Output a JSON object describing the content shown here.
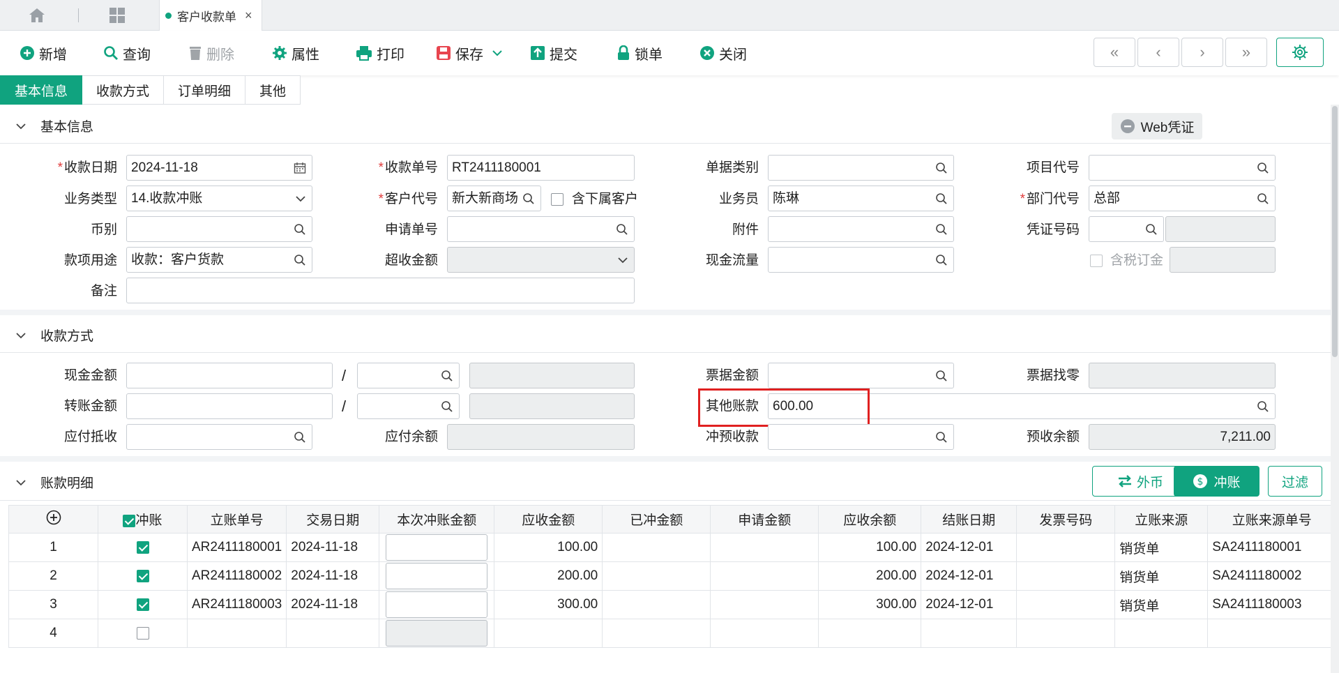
{
  "tabstrip": {
    "doc_tab_label": "客户收款单",
    "close_glyph": "×"
  },
  "toolbar": {
    "new": "新增",
    "query": "查询",
    "delete": "删除",
    "properties": "属性",
    "print": "打印",
    "save": "保存",
    "submit": "提交",
    "lock": "锁单",
    "close": "关闭",
    "nav_first": "«",
    "nav_prev": "‹",
    "nav_next": "›",
    "nav_last": "»"
  },
  "section_tabs": [
    "基本信息",
    "收款方式",
    "订单明细",
    "其他"
  ],
  "basic": {
    "title": "基本信息",
    "web_voucher": "Web凭证",
    "labels": {
      "receipt_date": "收款日期",
      "receipt_no": "收款单号",
      "doc_type": "单据类别",
      "project_code": "项目代号",
      "biz_type": "业务类型",
      "customer_code": "客户代号",
      "include_sub": "含下属客户",
      "salesperson": "业务员",
      "dept_code": "部门代号",
      "currency": "币别",
      "apply_no": "申请单号",
      "attachment": "附件",
      "voucher_no": "凭证号码",
      "purpose": "款项用途",
      "over_amount": "超收金额",
      "cash_flow": "现金流量",
      "tax_deposit": "含税订金",
      "remark": "备注"
    },
    "values": {
      "receipt_date": "2024-11-18",
      "receipt_no": "RT2411180001",
      "doc_type": "",
      "project_code": "",
      "biz_type": "14.收款冲账",
      "customer_code": "新大新商场",
      "salesperson": "陈琳",
      "dept_code": "总部",
      "currency": "",
      "apply_no": "",
      "attachment": "",
      "voucher_no": "",
      "purpose": "收款：客户货款",
      "over_amount": "",
      "cash_flow": "",
      "remark": ""
    }
  },
  "payment": {
    "title": "收款方式",
    "labels": {
      "cash_amount": "现金金额",
      "bill_amount": "票据金额",
      "bill_change": "票据找零",
      "transfer_amount": "转账金额",
      "other_account": "其他账款",
      "payable_offset": "应付抵收",
      "payable_balance": "应付余额",
      "offset_prepaid": "冲预收款",
      "prepaid_balance": "预收余额"
    },
    "values": {
      "other_account": "600.00",
      "prepaid_balance": "7,211.00"
    }
  },
  "ledger": {
    "title": "账款明细",
    "buttons": {
      "foreign": "外币",
      "offset": "冲账",
      "filter": "过滤"
    },
    "columns": [
      "冲账",
      "立账单号",
      "交易日期",
      "本次冲账金额",
      "应收金额",
      "已冲金额",
      "申请金额",
      "应收余额",
      "结账日期",
      "发票号码",
      "立账来源",
      "立账来源单号"
    ],
    "rows": [
      {
        "no": "1",
        "checked": true,
        "ar_no": "AR2411180001",
        "date": "2024-11-18",
        "receivable": "100.00",
        "balance": "100.00",
        "close_date": "2024-12-01",
        "source": "销货单",
        "source_no": "SA2411180001"
      },
      {
        "no": "2",
        "checked": true,
        "ar_no": "AR2411180002",
        "date": "2024-11-18",
        "receivable": "200.00",
        "balance": "200.00",
        "close_date": "2024-12-01",
        "source": "销货单",
        "source_no": "SA2411180002"
      },
      {
        "no": "3",
        "checked": true,
        "ar_no": "AR2411180003",
        "date": "2024-11-18",
        "receivable": "300.00",
        "balance": "300.00",
        "close_date": "2024-12-01",
        "source": "销货单",
        "source_no": "SA2411180003"
      },
      {
        "no": "4",
        "checked": false,
        "ar_no": "",
        "date": "",
        "receivable": "",
        "balance": "",
        "close_date": "",
        "source": "",
        "source_no": ""
      }
    ]
  },
  "colors": {
    "accent": "#10a37f",
    "required": "#e03b3b",
    "highlight": "#e02020"
  }
}
